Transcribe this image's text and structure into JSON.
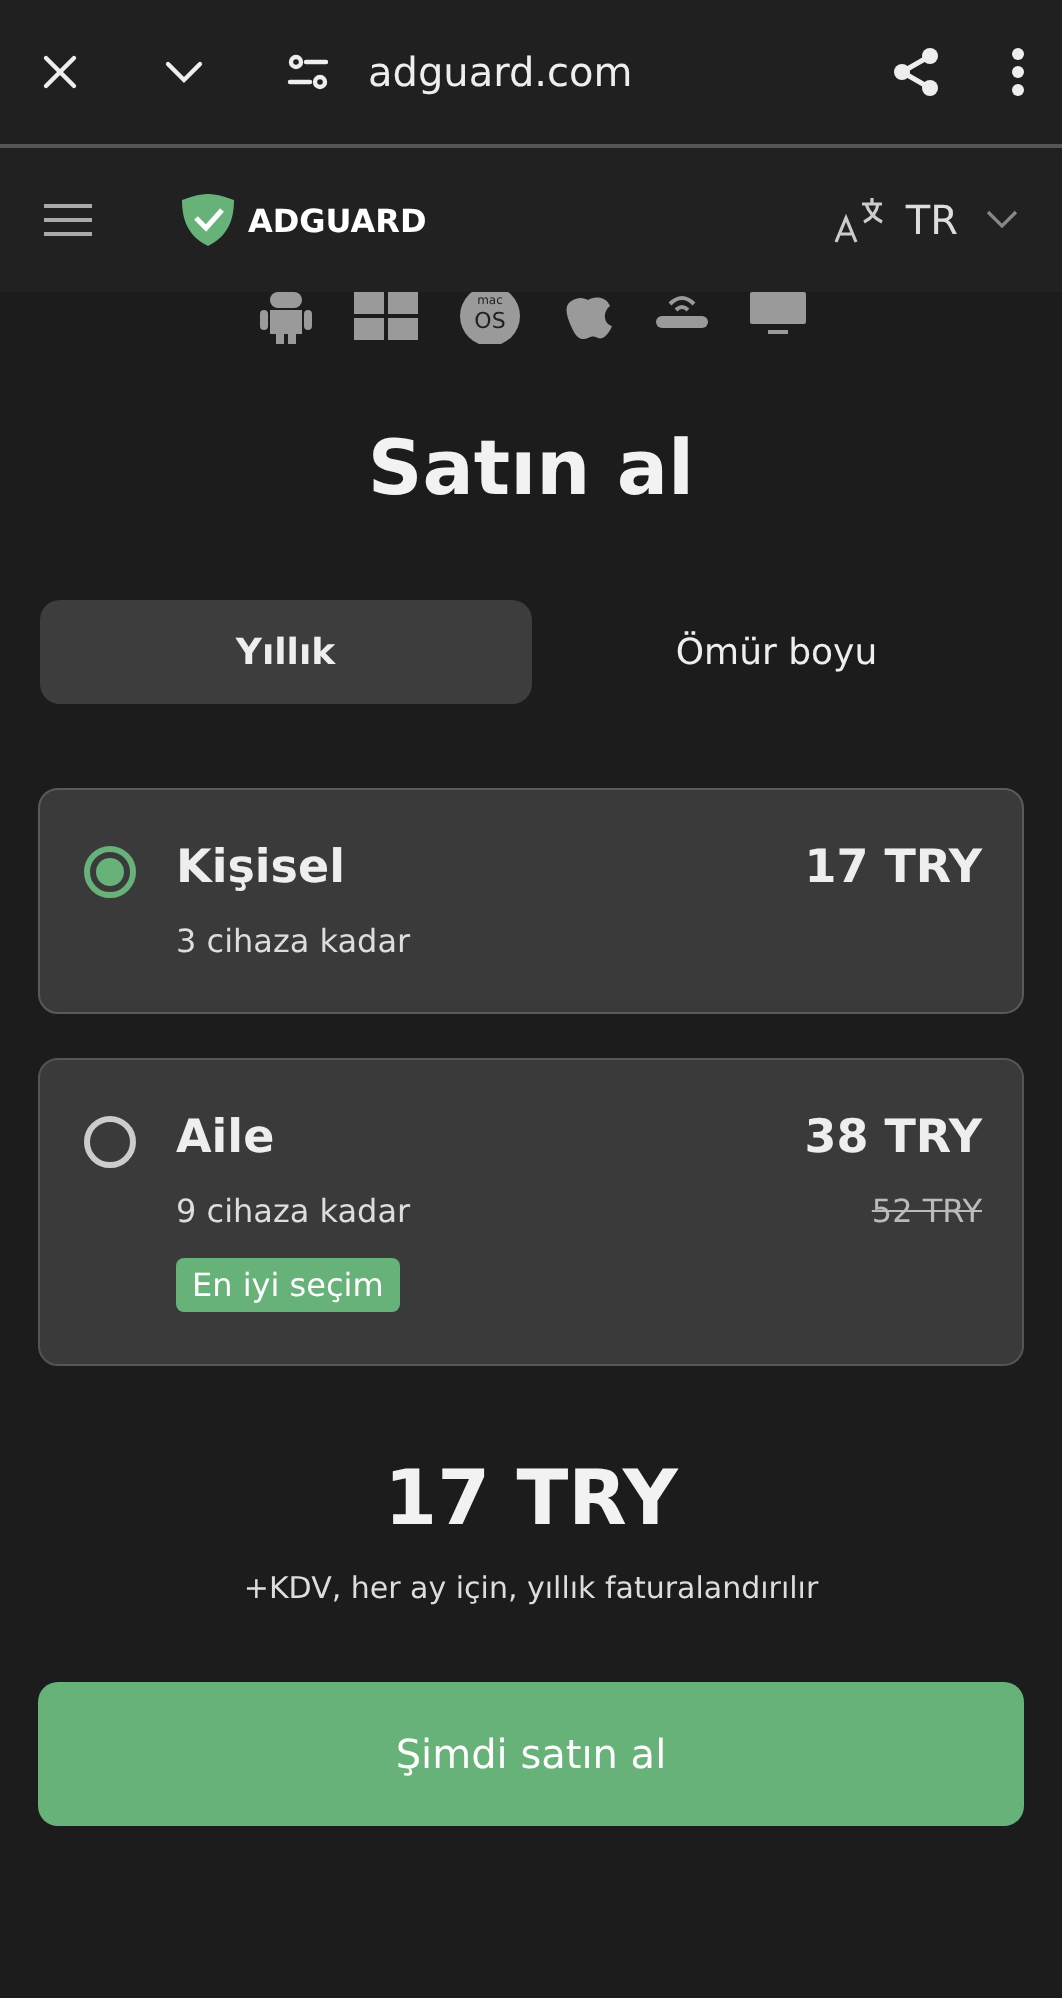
{
  "browser_bar": {
    "url": "adguard.com"
  },
  "site_header": {
    "logo": "ADGUARD",
    "language": "TR"
  },
  "platforms": [
    {
      "kind": "android"
    },
    {
      "kind": "windows"
    },
    {
      "kind": "macos",
      "text": [
        "mac",
        "OS"
      ]
    },
    {
      "kind": "ios"
    },
    {
      "kind": "router"
    },
    {
      "kind": "tv"
    }
  ],
  "title": "Satın al",
  "tabs": [
    {
      "label": "Yıllık",
      "selected": true
    },
    {
      "label": "Ömür boyu",
      "selected": false
    }
  ],
  "plans": [
    {
      "name": "Kişisel",
      "devices": "3 cihaza kadar",
      "price": "17 TRY",
      "selected": true
    },
    {
      "name": "Aile",
      "devices": "9 cihaza kadar",
      "price": "38 TRY",
      "old_price": "52 TRY",
      "badge": "En iyi seçim",
      "selected": false
    }
  ],
  "total": "17 TRY",
  "note": "+KDV, her ay için, yıllık faturalandırılır",
  "buy_button": "Şimdi satın al"
}
